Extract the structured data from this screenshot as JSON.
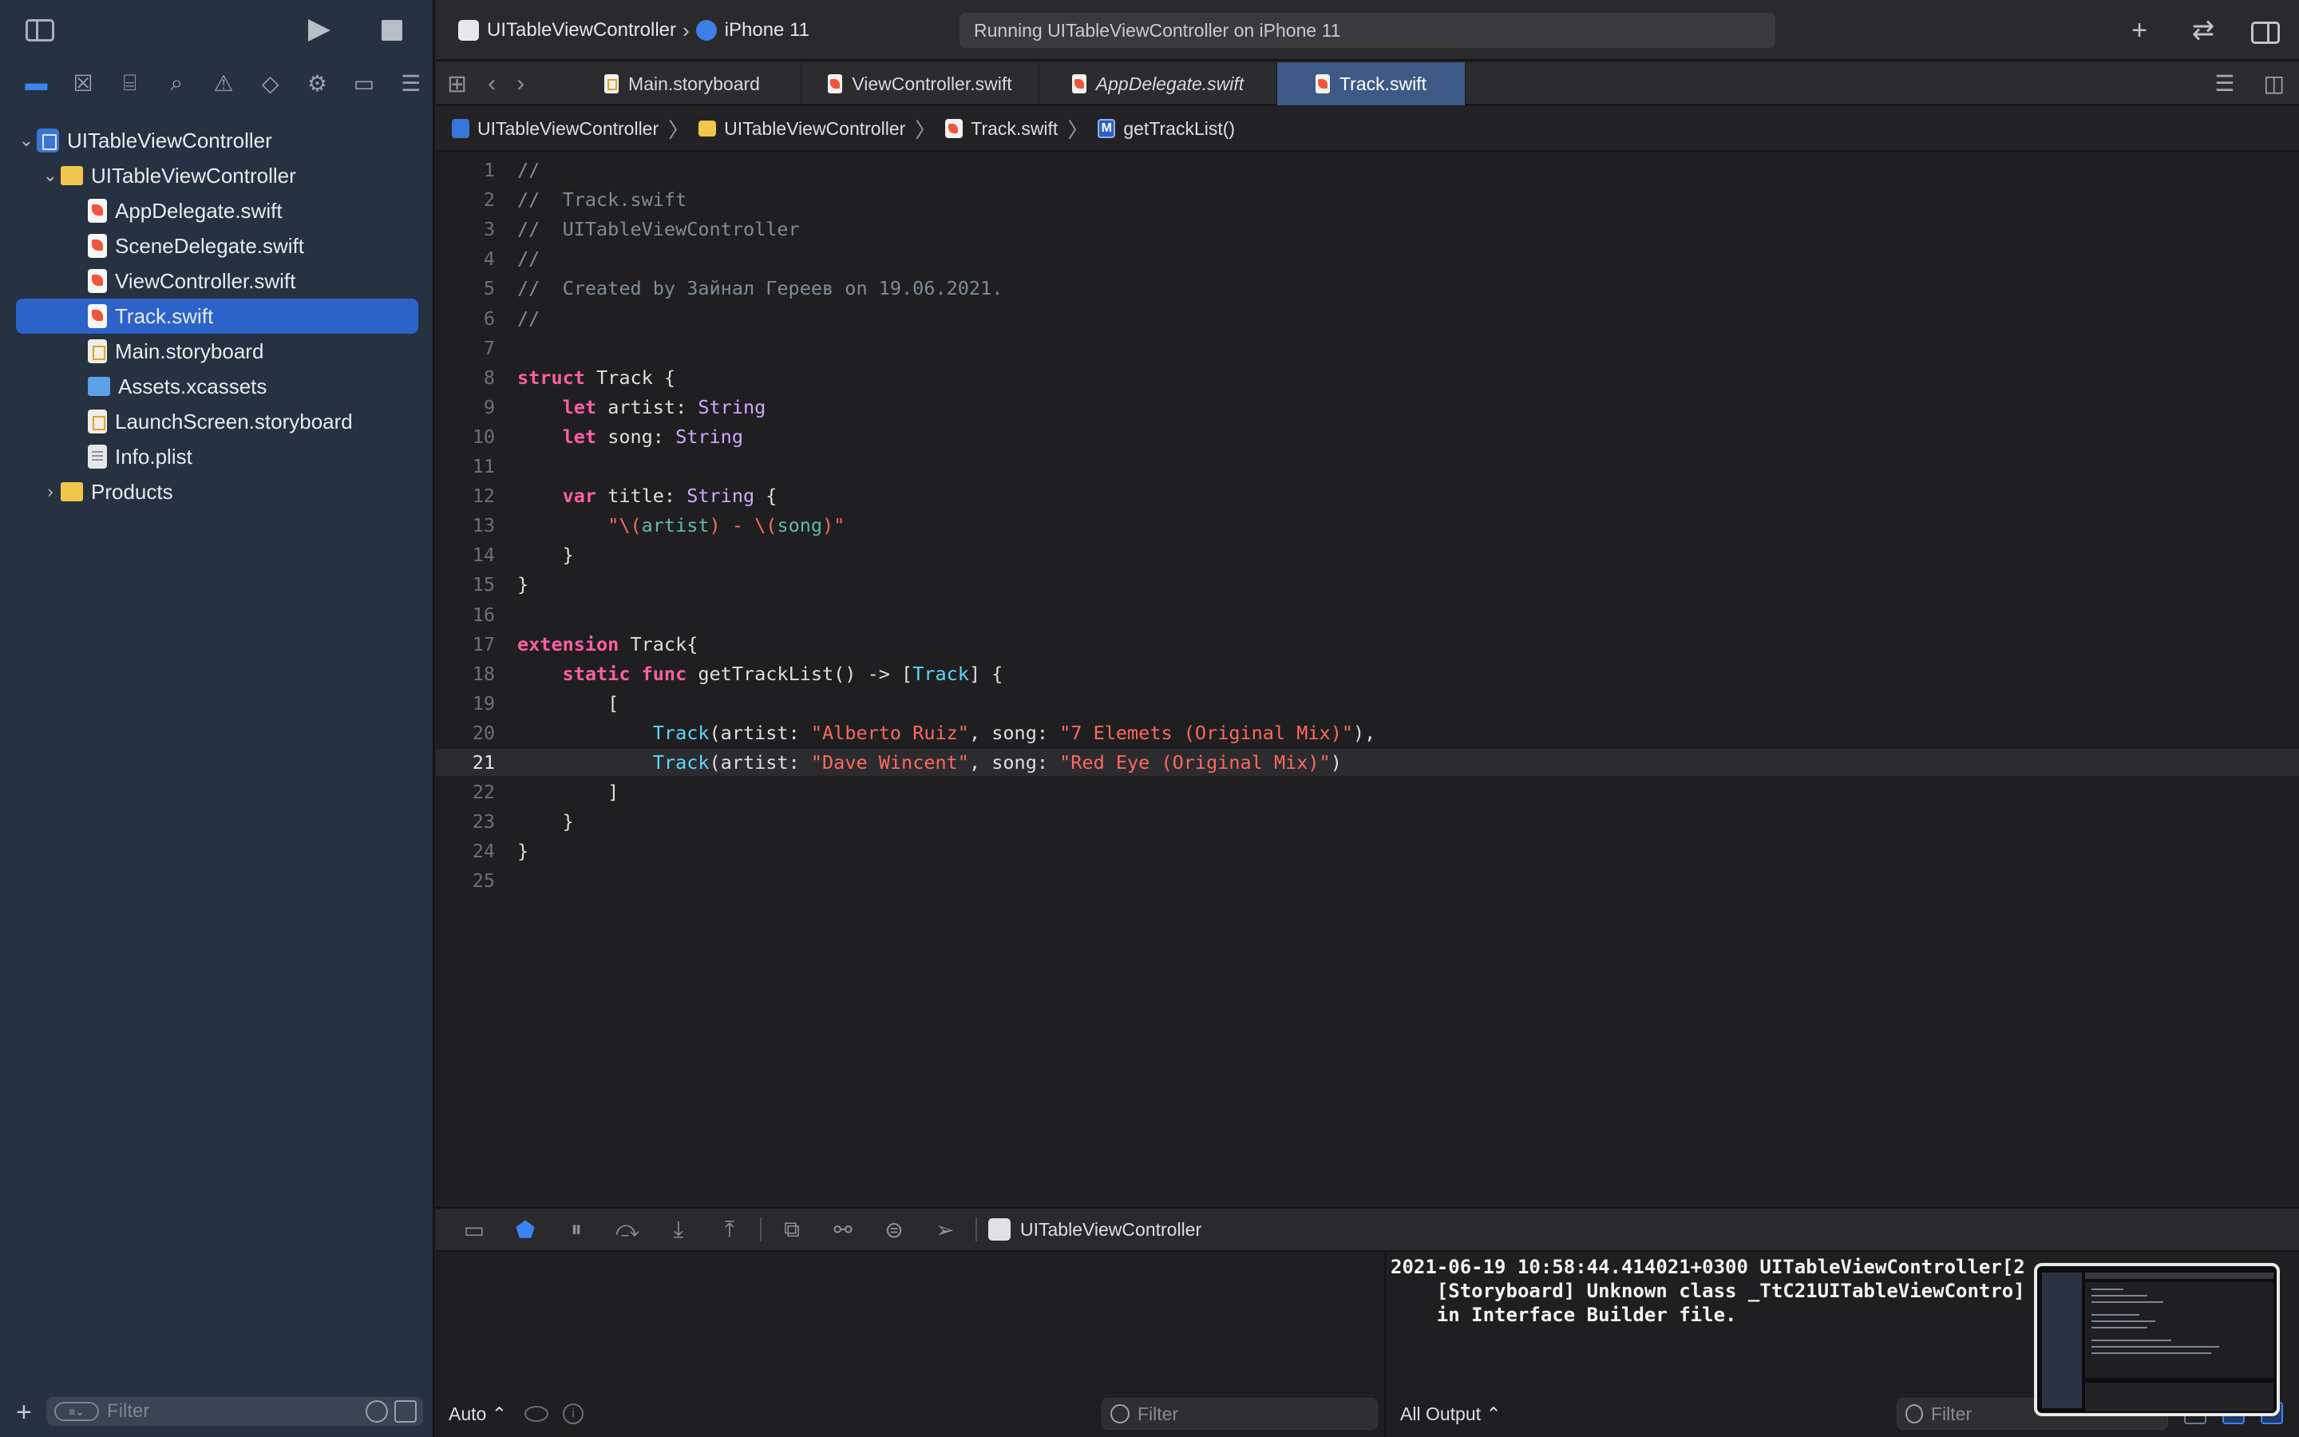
{
  "toolbar": {
    "scheme": "UITableViewController",
    "device": "iPhone 11",
    "activity": "Running UITableViewController on iPhone 11",
    "run_icon": "play-icon",
    "stop_icon": "stop-icon",
    "add_icon": "plus-icon",
    "review_icon": "arrows-swap-icon"
  },
  "navigator_icons": [
    "folder-icon",
    "source-control-icon",
    "symbol-icon",
    "search-icon",
    "issue-warning-icon",
    "test-diamond-icon",
    "debug-spray-icon",
    "breakpoint-icon",
    "report-icon"
  ],
  "project_tree": [
    {
      "label": "UITableViewController",
      "kind": "project",
      "expanded": true
    },
    {
      "label": "UITableViewController",
      "kind": "folder",
      "expanded": true
    },
    {
      "label": "AppDelegate.swift",
      "kind": "swift"
    },
    {
      "label": "SceneDelegate.swift",
      "kind": "swift"
    },
    {
      "label": "ViewController.swift",
      "kind": "swift"
    },
    {
      "label": "Track.swift",
      "kind": "swift",
      "selected": true
    },
    {
      "label": "Main.storyboard",
      "kind": "storyboard"
    },
    {
      "label": "Assets.xcassets",
      "kind": "assets"
    },
    {
      "label": "LaunchScreen.storyboard",
      "kind": "storyboard"
    },
    {
      "label": "Info.plist",
      "kind": "plist"
    },
    {
      "label": "Products",
      "kind": "folder",
      "expanded": false
    }
  ],
  "sidebar_filter": {
    "placeholder": "Filter"
  },
  "tabs": [
    {
      "label": "Main.storyboard",
      "icon": "storyboard-file-icon"
    },
    {
      "label": "ViewController.swift",
      "icon": "swift-file-icon"
    },
    {
      "label": "AppDelegate.swift",
      "icon": "swift-file-icon",
      "italic": true
    },
    {
      "label": "Track.swift",
      "icon": "swift-file-icon",
      "active": true
    }
  ],
  "breadcrumb": [
    "UITableViewController",
    "UITableViewController",
    "Track.swift",
    "getTrackList()"
  ],
  "breadcrumb_method_badge": "M",
  "editor": {
    "current_line": 21,
    "lines": [
      "//",
      "//  Track.swift",
      "//  UITableViewController",
      "//",
      "//  Created by Зайнал Гереев on 19.06.2021.",
      "//",
      "",
      "struct Track {",
      "    let artist: String",
      "    let song: String",
      "",
      "    var title: String {",
      "        \"\\(artist) - \\(song)\"",
      "    }",
      "}",
      "",
      "extension Track{",
      "    static func getTrackList() -> [Track] {",
      "        [",
      "            Track(artist: \"Alberto Ruiz\", song: \"7 Elemets (Original Mix)\"),",
      "            Track(artist: \"Dave Wincent\", song: \"Red Eye (Original Mix)\")",
      "        ]",
      "    }",
      "}",
      ""
    ]
  },
  "debug_bar": {
    "target": "UITableViewController"
  },
  "variables_pane": {
    "mode": "Auto ⌃",
    "filter_placeholder": "Filter"
  },
  "console": {
    "text": "2021-06-19 10:58:44.414021+0300 UITableViewController[2\n    [Storyboard] Unknown class _TtC21UITableViewContro]\n    in Interface Builder file.",
    "output_mode": "All Output ⌃",
    "filter_placeholder": "Filter"
  },
  "colors": {
    "sidebar_bg": "#263141",
    "selection": "#2b63c8",
    "active_tab": "#3d5a86",
    "keyword": "#fc5fa3",
    "string": "#fc6a5d",
    "type": "#d0a8ff",
    "comment": "#7f8c98"
  }
}
